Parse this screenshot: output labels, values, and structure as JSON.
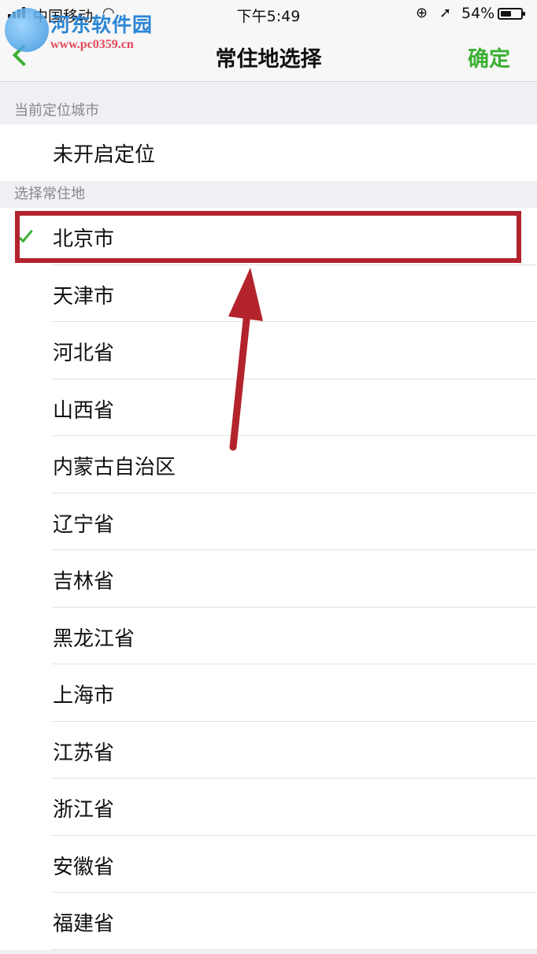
{
  "status_bar": {
    "carrier": "中国移动",
    "time": "下午5:49",
    "battery": "54%",
    "battery_level": 0.54,
    "icons": [
      "signal-icon",
      "wifi-icon",
      "orientation-lock-icon",
      "location-icon",
      "battery-icon"
    ]
  },
  "watermark": {
    "title": "河东软件园",
    "url": "www.pc0359.cn"
  },
  "nav": {
    "title": "常住地选择",
    "confirm": "确定",
    "back_icon": "chevron-left-icon"
  },
  "sections": {
    "current_header": "当前定位城市",
    "current_value": "未开启定位",
    "select_header": "选择常住地"
  },
  "regions": [
    {
      "label": "北京市",
      "selected": true
    },
    {
      "label": "天津市",
      "selected": false
    },
    {
      "label": "河北省",
      "selected": false
    },
    {
      "label": "山西省",
      "selected": false
    },
    {
      "label": "内蒙古自治区",
      "selected": false
    },
    {
      "label": "辽宁省",
      "selected": false
    },
    {
      "label": "吉林省",
      "selected": false
    },
    {
      "label": "黑龙江省",
      "selected": false
    },
    {
      "label": "上海市",
      "selected": false
    },
    {
      "label": "江苏省",
      "selected": false
    },
    {
      "label": "浙江省",
      "selected": false
    },
    {
      "label": "安徽省",
      "selected": false
    },
    {
      "label": "福建省",
      "selected": false
    }
  ],
  "colors": {
    "accent": "#3cb034",
    "annotation": "#b3232b",
    "background": "#efeff4"
  }
}
